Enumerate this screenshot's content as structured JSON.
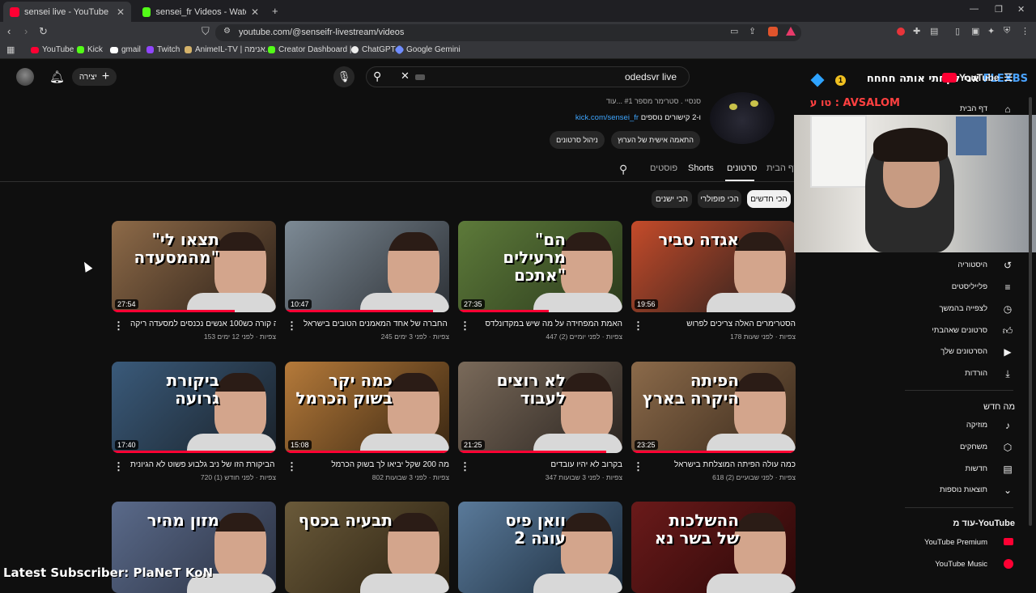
{
  "browser": {
    "tabs": [
      {
        "title": "sensei live - YouTube",
        "active": true
      },
      {
        "title": "sensei_fr Videos - Watch On-Demand",
        "active": false
      }
    ],
    "new_tab_icon": "plus-icon",
    "url": "youtube.com/@senseifr-livestream/videos",
    "bookmarks": [
      "YouTube",
      "Kick",
      "gmail",
      "Twitch",
      "AnimeIL-TV | אנימה...",
      "Creator Dashboard |...",
      "ChatGPT",
      "Google Gemini"
    ]
  },
  "youtube": {
    "create_label": "יצירה",
    "search_value": "odedsvr live",
    "logo_label": "YouTube",
    "channel": {
      "subtitle": "סנסיי . סטרימר מספר #1 ...עוד",
      "links_prefix": "kick.com/sensei_fr",
      "links_suffix": " ו-2 קישורים נוספים",
      "manage_label": "ניהול סרטונים",
      "customize_label": "התאמה אישית של הערוץ"
    },
    "tabs": [
      "דף הבית",
      "סרטונים",
      "Shorts",
      "פוסטים"
    ],
    "chips": [
      "הכי חדשים",
      "הכי פופולרי",
      "הכי ישנים"
    ],
    "videos": [
      {
        "title": "הסטרימרים האלה צריכים לפרוש",
        "views": "178 צפיות",
        "age": "לפני שעות",
        "duration": "19:56",
        "thumb_text": "אגדה סביר"
      },
      {
        "title": "האמת המפחידה על מה שיש במקדונלדס",
        "views": "447 צפיות",
        "age": "לפני יומיים (2)",
        "duration": "27:35",
        "thumb_text": "\"הם מרעילים אתכם\""
      },
      {
        "title": "זו החברה של אחד המאמנים הטובים בישראל?",
        "views": "245 צפיות",
        "age": "לפני 3 ימים",
        "duration": "10:47",
        "thumb_text": ""
      },
      {
        "title": "מה קורה כש100 אנשים נכנסים למסעדה ריקה",
        "views": "153 צפיות",
        "age": "לפני 12 ימים",
        "duration": "27:54",
        "thumb_text": "\"תצאו לי מהמסעדה\""
      },
      {
        "title": "כמה עולה הפיתה המוצלחת בישראל",
        "views": "618 צפיות",
        "age": "לפני שבועיים (2)",
        "duration": "23:25",
        "thumb_text": "הפיתה היקרה בארץ"
      },
      {
        "title": "בקרוב לא יהיו עובדים",
        "views": "347 צפיות",
        "age": "לפני 3 שבועות",
        "duration": "21:25",
        "thumb_text": "לא רוצים לעבוד"
      },
      {
        "title": "מה 200 שקל יביאו לך בשוק הכרמל",
        "views": "802 צפיות",
        "age": "לפני 3 שבועות",
        "duration": "15:08",
        "thumb_text": "כמה יקר בשוק הכרמל"
      },
      {
        "title": "למה הביקורת הזו של ניב גלבוע פשוט לא הגיונית",
        "views": "720 צפיות",
        "age": "לפני חודש (1)",
        "duration": "17:40",
        "thumb_text": "ביקורת גרועה"
      },
      {
        "title": "",
        "views": "",
        "age": "",
        "duration": "",
        "thumb_text": "ההשלכות של בשר נא"
      },
      {
        "title": "",
        "views": "",
        "age": "",
        "duration": "",
        "thumb_text": "וואן פיס עונה 2"
      },
      {
        "title": "",
        "views": "",
        "age": "",
        "duration": "",
        "thumb_text": "תבעיה בכסף"
      },
      {
        "title": "",
        "views": "",
        "age": "",
        "duration": "",
        "thumb_text": "מזון מהיר"
      }
    ],
    "sidebar": {
      "top": [
        "דף הבית"
      ],
      "you": [
        "היסטוריה",
        "פלייליסטים",
        "לצפייה בהמשך",
        "סרטונים שאהבתי",
        "הסרטונים שלך",
        "הורדות"
      ],
      "explore_title": "מה חדש",
      "explore": [
        "מוזיקה",
        "משחקים",
        "חדשות",
        "תוצאות נוספות"
      ],
      "more_title": "עוד מ-YouTube",
      "more": [
        "YouTube Premium",
        "YouTube Music"
      ]
    }
  },
  "stream_overlay": {
    "title": "אני לקחתי אותה חחחח",
    "user": "FLEXBS",
    "sub_line": "טו ע : AVSALOM",
    "latest_subscriber": "Latest Subscriber: PlaNeT KoN"
  }
}
